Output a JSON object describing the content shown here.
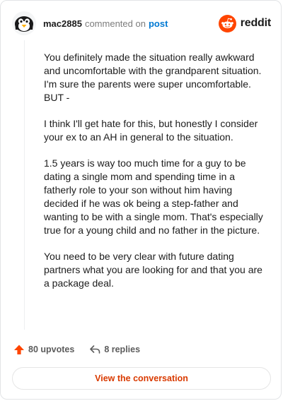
{
  "comment": {
    "username": "mac2885",
    "action_text": "commented on",
    "post_link_label": "post",
    "paragraphs": [
      "You definitely made the situation really awkward and uncomfortable with the grandparent situation. I'm sure the parents were super uncomfortable. BUT -",
      "I think I'll get hate for this, but honestly I consider your ex to an AH in general to the situation.",
      "1.5 years is way too much time for a guy to be dating a single mom and spending time in a fatherly role to your son without him having decided if he was ok being a step-father and wanting to be with a single mom. That's especially true for a young child and no father in the picture.",
      "You need to be very clear with future dating partners what you are looking for and that you are a package deal."
    ]
  },
  "brand": {
    "name": "reddit",
    "color": "#ff4500"
  },
  "footer": {
    "upvotes": "80 upvotes",
    "replies": "8 replies",
    "cta_label": "View the conversation"
  },
  "icons": {
    "avatar": "penguin-avatar-icon",
    "brand": "reddit-snoo-icon",
    "upvote": "upvote-arrow-icon",
    "reply": "reply-arrow-icon"
  },
  "colors": {
    "accent": "#ff4500",
    "link": "#0079d3",
    "cta_text": "#d93a00",
    "muted": "#7c7c7c"
  }
}
